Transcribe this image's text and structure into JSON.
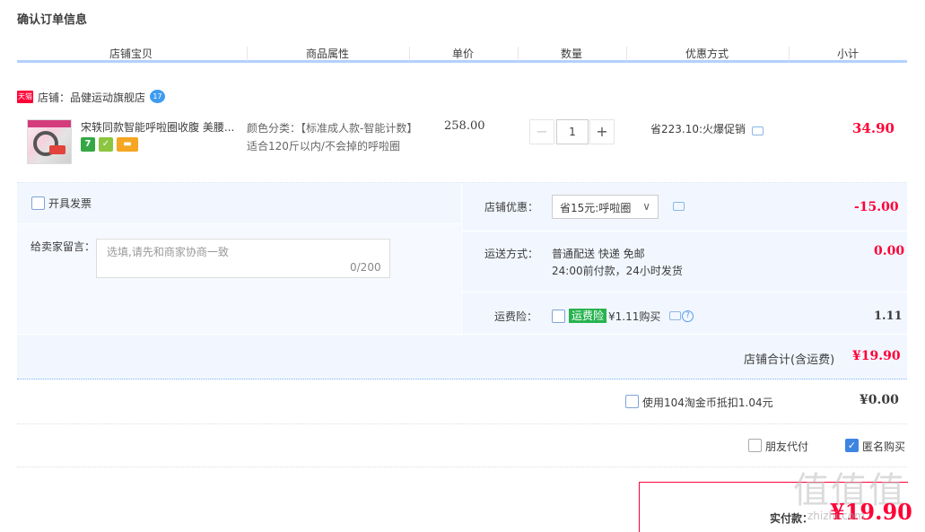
{
  "page_title": "确认订单信息",
  "columns": [
    "店铺宝贝",
    "商品属性",
    "单价",
    "数量",
    "优惠方式",
    "小计"
  ],
  "shop": {
    "badge": "天猫",
    "name": "店铺：品健运动旗舰店",
    "chat_badge": "17"
  },
  "item": {
    "title": "宋轶同款智能呼啦圈收腹 美腰...",
    "badges": [
      {
        "icon": "seven-day-return-icon",
        "text": "7",
        "color": "#35a844"
      },
      {
        "icon": "guarantee-icon",
        "text": "✓",
        "color": "#8cc63f"
      },
      {
        "icon": "card-payment-icon",
        "text": "▬",
        "color": "#f5a623"
      }
    ],
    "property": "颜色分类：【标准成人款-智能计数】适合120斤以内/不会掉的呼啦圈",
    "unit_price": "258.00",
    "quantity": "1",
    "promotion": "省223.10:火爆促销",
    "subtotal": "34.90"
  },
  "invoice": {
    "label": "开具发票"
  },
  "note": {
    "label": "给卖家留言：",
    "placeholder": "选填,请先和商家协商一致",
    "counter": "0/200"
  },
  "shop_discount": {
    "label": "店铺优惠：",
    "selected": "省15元:呼啦圈",
    "value": "-15.00"
  },
  "shipping": {
    "label": "运送方式：",
    "method": "普通配送 快递 免邮",
    "desc": "24:00前付款，24小时发货",
    "value": "0.00"
  },
  "insurance": {
    "label": "运费险：",
    "tag": "运费险",
    "price_text": "¥1.11购买",
    "value": "1.11"
  },
  "shop_total": {
    "label": "店铺合计(含运费)",
    "value": "¥19.90"
  },
  "coins": {
    "label": "使用104淘金币抵扣1.04元",
    "value": "¥0.00"
  },
  "options": {
    "friend_pay": "朋友代付",
    "anonymous": "匿名购买"
  },
  "final": {
    "label": "实付款：",
    "value": "¥19.90"
  },
  "watermark": {
    "big": "值值值",
    "small": "zhizhi.com"
  },
  "colors": {
    "price_red": "#ff0036",
    "header_line": "#b2d1ff",
    "panel_bg": "#f2f7ff",
    "insurance_green": "#27b34f",
    "check_blue": "#3e84e2"
  }
}
